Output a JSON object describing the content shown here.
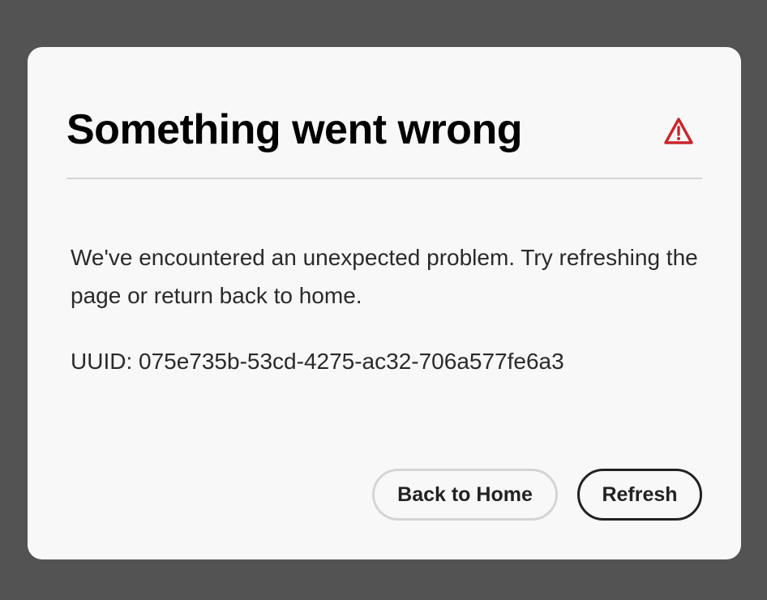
{
  "dialog": {
    "title": "Something went wrong",
    "icon": "alert-triangle-icon",
    "icon_color": "#c9252d",
    "message": "We've encountered an unexpected problem. Try refreshing the page or return back to home.",
    "uuid_text": "UUID: 075e735b-53cd-4275-ac32-706a577fe6a3",
    "buttons": {
      "back_home_label": "Back to Home",
      "refresh_label": "Refresh"
    }
  },
  "colors": {
    "backdrop": "#535353",
    "dialog_bg": "#f8f8f8",
    "text": "#2a2a2a"
  }
}
